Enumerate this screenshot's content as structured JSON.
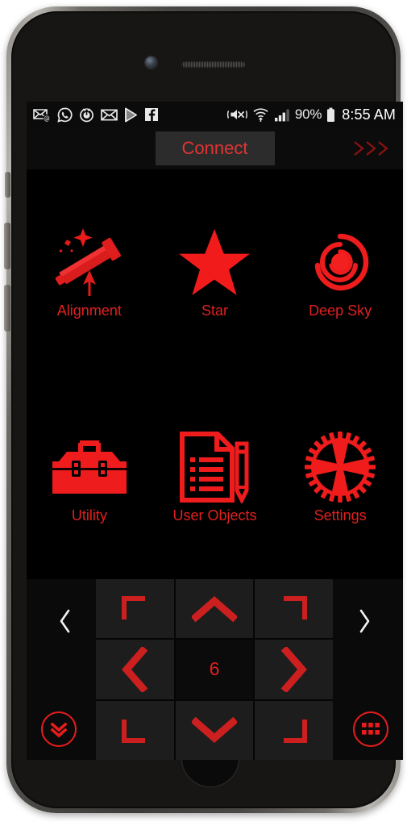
{
  "status_bar": {
    "left_icons": [
      {
        "name": "email-at-icon",
        "label": "Email"
      },
      {
        "name": "whatsapp-icon",
        "label": "WhatsApp"
      },
      {
        "name": "alarm-clock-icon",
        "label": "Alarm"
      },
      {
        "name": "envelope-icon",
        "label": "Messages"
      },
      {
        "name": "play-store-icon",
        "label": "Play Store"
      },
      {
        "name": "facebook-icon",
        "label": "Facebook"
      }
    ],
    "right_icons": [
      {
        "name": "vibrate-mute-icon",
        "label": "Vibrate"
      },
      {
        "name": "wifi-icon",
        "label": "Wi-Fi"
      },
      {
        "name": "cellular-signal-icon",
        "label": "Signal"
      }
    ],
    "battery_percent": "90%",
    "battery_icon": "battery-full-icon",
    "clock": "8:55 AM"
  },
  "top_bar": {
    "connect_label": "Connect",
    "connect_bg_color": "#2c2c2c",
    "connect_text_color": "#e23434",
    "forward_chevrons_name": "triple-chevron-right-icon",
    "forward_chevrons_glyph": "〉"
  },
  "main_grid": {
    "tiles": [
      {
        "id": "alignment",
        "label": "Alignment",
        "icon": "telescope-icon"
      },
      {
        "id": "star",
        "label": "Star",
        "icon": "star-icon"
      },
      {
        "id": "deep-sky",
        "label": "Deep Sky",
        "icon": "galaxy-spiral-icon"
      },
      {
        "id": "utility",
        "label": "Utility",
        "icon": "toolbox-icon"
      },
      {
        "id": "user-objects",
        "label": "User Objects",
        "icon": "document-pencil-icon"
      },
      {
        "id": "settings",
        "label": "Settings",
        "icon": "gear-icon"
      }
    ],
    "label_color": "#e02020",
    "icon_color": "#ec1b1b"
  },
  "dpad": {
    "cells": [
      {
        "id": "top-left",
        "icon": "corner-top-left-icon"
      },
      {
        "id": "up",
        "icon": "chevron-up-icon"
      },
      {
        "id": "top-right",
        "icon": "corner-top-right-icon"
      },
      {
        "id": "left",
        "icon": "chevron-left-icon"
      },
      {
        "id": "center",
        "icon": "speed-value",
        "value": "6"
      },
      {
        "id": "right",
        "icon": "chevron-right-icon"
      },
      {
        "id": "bottom-left",
        "icon": "corner-bottom-left-icon"
      },
      {
        "id": "down",
        "icon": "chevron-down-icon"
      },
      {
        "id": "bottom-right",
        "icon": "corner-bottom-right-icon"
      }
    ],
    "speed_value": "6",
    "prev_arrow_glyph": "‹",
    "next_arrow_glyph": "›",
    "collapse_button_icon": "double-chevron-down-circle-icon",
    "keypad_button_icon": "grid-squares-circle-icon",
    "cell_bg_color": "#1d1d1d",
    "center_bg_color": "#0b0b0b",
    "arrow_color": "#cc1f1f"
  },
  "device": {
    "camera_name": "front-camera",
    "speaker_name": "earpiece-speaker",
    "home_button_name": "home-button"
  }
}
